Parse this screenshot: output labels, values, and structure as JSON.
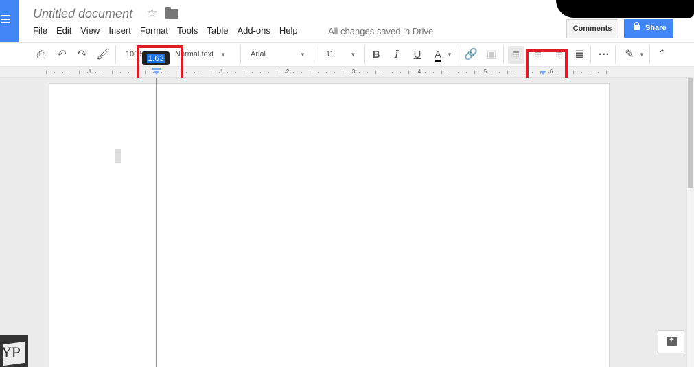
{
  "app": {
    "title": "Untitled document",
    "menu": [
      "File",
      "Edit",
      "View",
      "Insert",
      "Format",
      "Tools",
      "Table",
      "Add-ons",
      "Help"
    ],
    "save_status": "All changes saved in Drive",
    "comments_label": "Comments",
    "share_label": "Share"
  },
  "toolbar": {
    "zoom": "100%",
    "style": "Normal text",
    "font": "Arial",
    "font_size": "11",
    "bold": "B",
    "italic": "I",
    "underline": "U",
    "text_color": "A"
  },
  "ruler": {
    "labels": [
      "1",
      "1",
      "2",
      "3",
      "4",
      "5",
      "6"
    ],
    "tooltip_value": "1.63"
  },
  "watermark": "YP",
  "colors": {
    "accent": "#4285f4",
    "highlight_box": "#e01b24",
    "marker": "#7baaf7"
  }
}
